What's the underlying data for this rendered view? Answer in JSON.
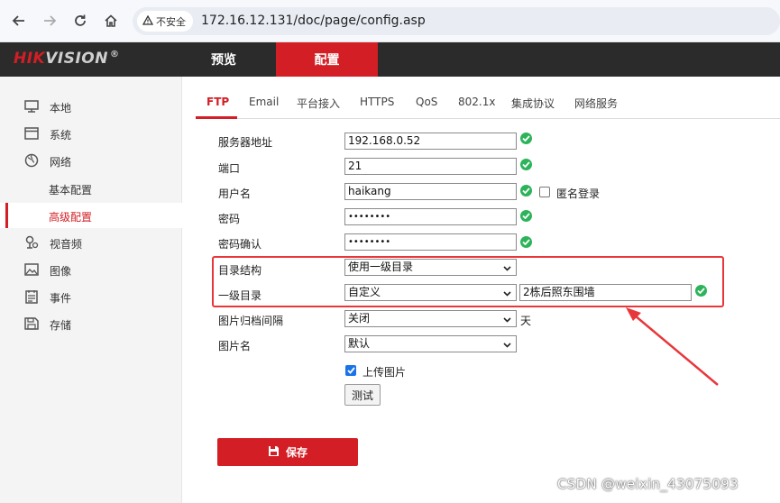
{
  "browser": {
    "insecure_label": "不安全",
    "url": "172.16.12.131/doc/page/config.asp"
  },
  "header": {
    "logo_hik": "HIK",
    "logo_vision": "VISION",
    "logo_reg": "®",
    "tabs": [
      {
        "label": "预览",
        "active": false
      },
      {
        "label": "配置",
        "active": true
      }
    ],
    "accent_color": "#d21e24"
  },
  "sidebar": {
    "items": [
      {
        "label": "本地",
        "icon": "monitor-icon"
      },
      {
        "label": "系统",
        "icon": "system-window-icon"
      },
      {
        "label": "网络",
        "icon": "globe-icon"
      },
      {
        "label": "基本配置",
        "sub": true
      },
      {
        "label": "高级配置",
        "sub": true,
        "active": true
      },
      {
        "label": "视音频",
        "icon": "microphone-icon"
      },
      {
        "label": "图像",
        "icon": "image-icon"
      },
      {
        "label": "事件",
        "icon": "event-list-icon"
      },
      {
        "label": "存储",
        "icon": "floppy-disk-icon"
      }
    ]
  },
  "subtabs": [
    "FTP",
    "Email",
    "平台接入",
    "HTTPS",
    "QoS",
    "802.1x",
    "集成协议",
    "网络服务"
  ],
  "form": {
    "server_label": "服务器地址",
    "server_value": "192.168.0.52",
    "port_label": "端口",
    "port_value": "21",
    "user_label": "用户名",
    "user_value": "haikang",
    "anonymous_label": "匿名登录",
    "anonymous_checked": false,
    "password_label": "密码",
    "password_value": "••••••••",
    "confirm_label": "密码确认",
    "confirm_value": "••••••••",
    "dir_structure_label": "目录结构",
    "dir_structure_value": "使用一级目录",
    "level1_label": "一级目录",
    "level1_select_value": "自定义",
    "level1_custom_value": "2栋后照东围墙",
    "interval_label": "图片归档间隔",
    "interval_value": "关闭",
    "interval_unit": "天",
    "picname_label": "图片名",
    "picname_value": "默认",
    "upload_label": "上传图片",
    "upload_checked": true,
    "test_label": "测试",
    "save_label": "保存"
  },
  "annotation": {
    "highlight_color": "#e8373a"
  },
  "watermark": "CSDN @weixin_43075093"
}
